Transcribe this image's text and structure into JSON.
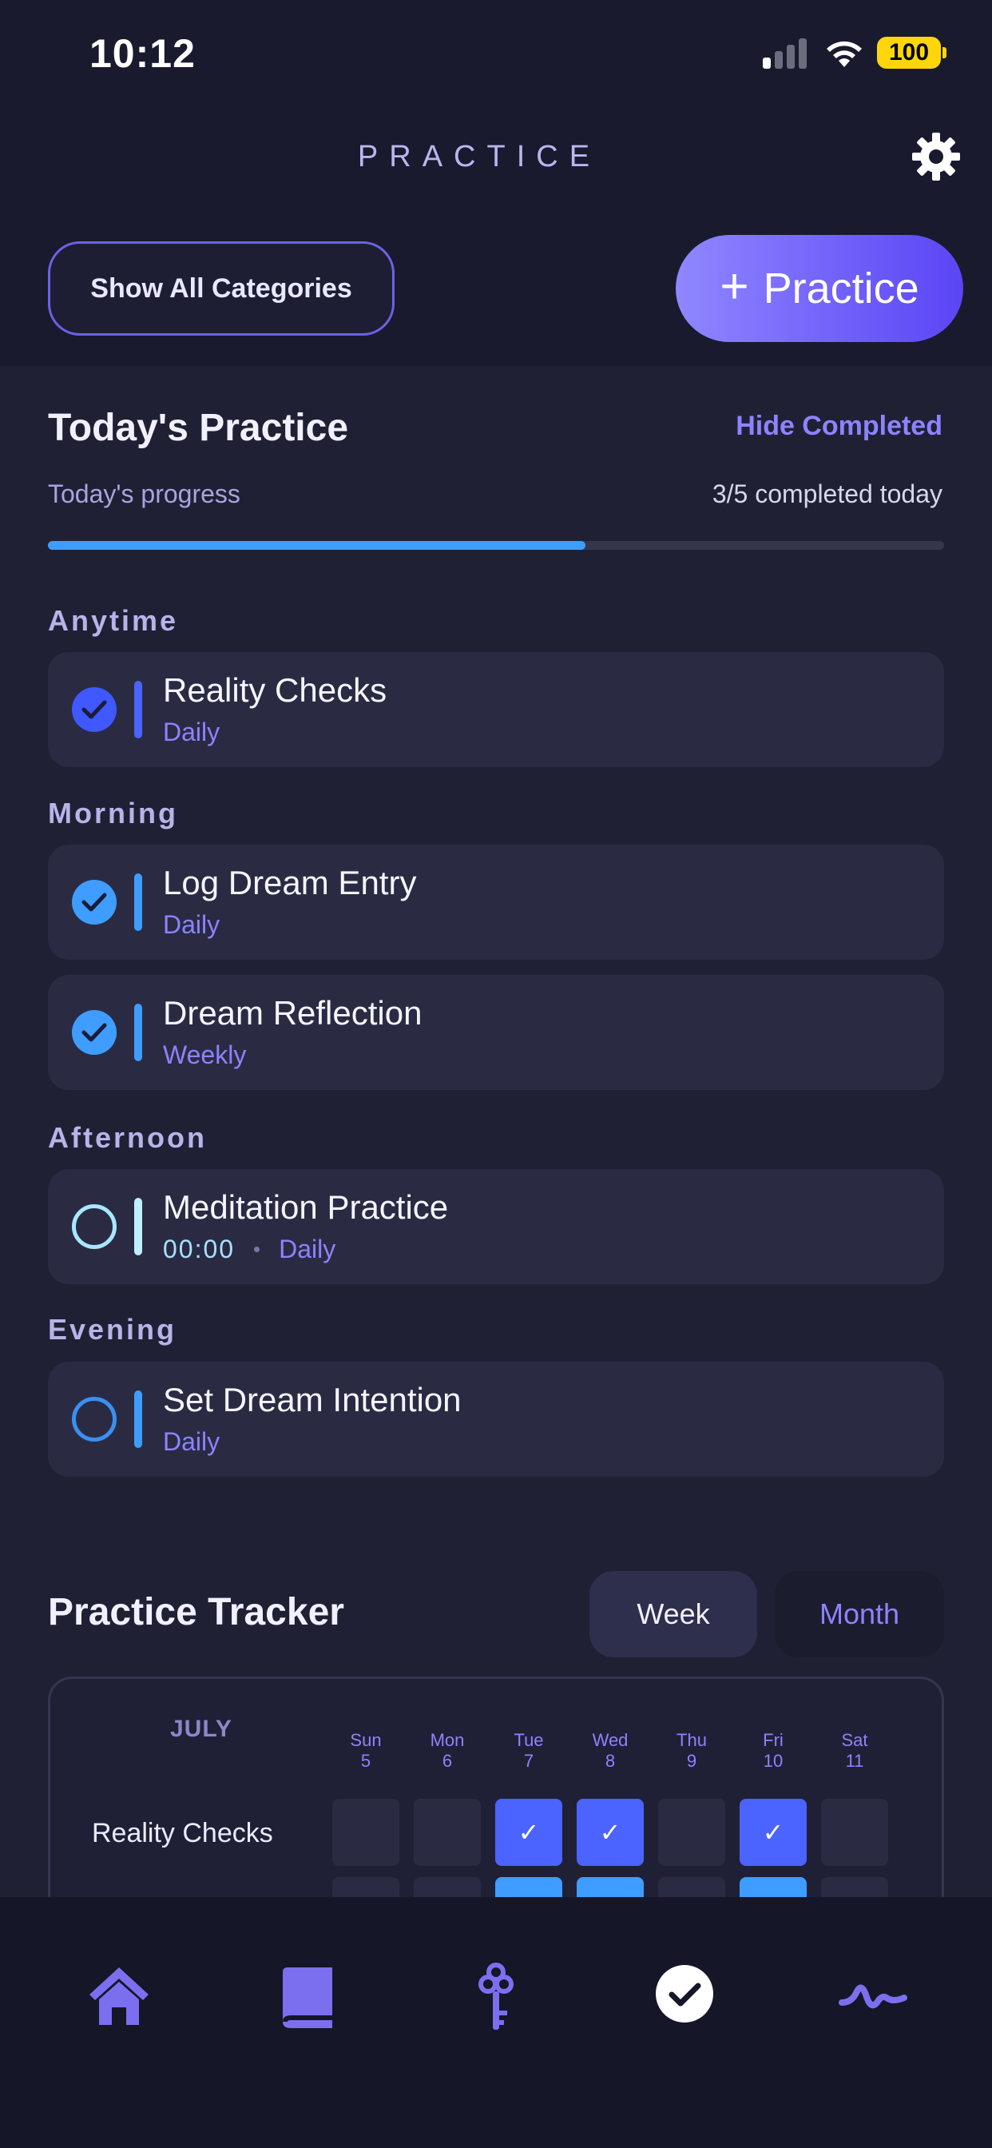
{
  "status_bar": {
    "time": "10:12",
    "battery": "100"
  },
  "header": {
    "title": "PRACTICE"
  },
  "actions": {
    "show_all_label": "Show All Categories",
    "add_plus": "+",
    "add_label": "Practice"
  },
  "today": {
    "title": "Today's Practice",
    "hide_completed_label": "Hide Completed",
    "progress_label": "Today's progress",
    "progress_text": "3/5 completed today",
    "progress_fraction": 0.6
  },
  "groups": [
    {
      "label": "Anytime",
      "items": [
        {
          "name": "Reality Checks",
          "frequency": "Daily",
          "done": true
        }
      ]
    },
    {
      "label": "Morning",
      "items": [
        {
          "name": "Log Dream Entry",
          "frequency": "Daily",
          "done": true
        },
        {
          "name": "Dream Reflection",
          "frequency": "Weekly",
          "done": true
        }
      ]
    },
    {
      "label": "Afternoon",
      "items": [
        {
          "name": "Meditation Practice",
          "time": "00:00",
          "frequency": "Daily",
          "done": false
        }
      ]
    },
    {
      "label": "Evening",
      "items": [
        {
          "name": "Set Dream Intention",
          "frequency": "Daily",
          "done": false
        }
      ]
    }
  ],
  "tracker": {
    "title": "Practice Tracker",
    "tabs": {
      "week": "Week",
      "month": "Month",
      "active": "Week"
    },
    "month": "JULY",
    "days": [
      {
        "name": "Sun",
        "num": "5"
      },
      {
        "name": "Mon",
        "num": "6"
      },
      {
        "name": "Tue",
        "num": "7"
      },
      {
        "name": "Wed",
        "num": "8"
      },
      {
        "name": "Thu",
        "num": "9"
      },
      {
        "name": "Fri",
        "num": "10"
      },
      {
        "name": "Sat",
        "num": "11"
      }
    ],
    "rows": [
      {
        "label": "Reality Checks",
        "checks": [
          false,
          false,
          true,
          true,
          false,
          true,
          false
        ],
        "tick": "✓"
      }
    ]
  },
  "nav": {
    "items": [
      "home-icon",
      "journal-icon",
      "key-icon",
      "practice-check-icon",
      "waveform-icon"
    ],
    "active": "practice-check-icon"
  },
  "colors": {
    "accent": "#8d83ff",
    "primary_blue": "#3e9dff",
    "indigo": "#4b63ff",
    "background": "#191a2e"
  }
}
